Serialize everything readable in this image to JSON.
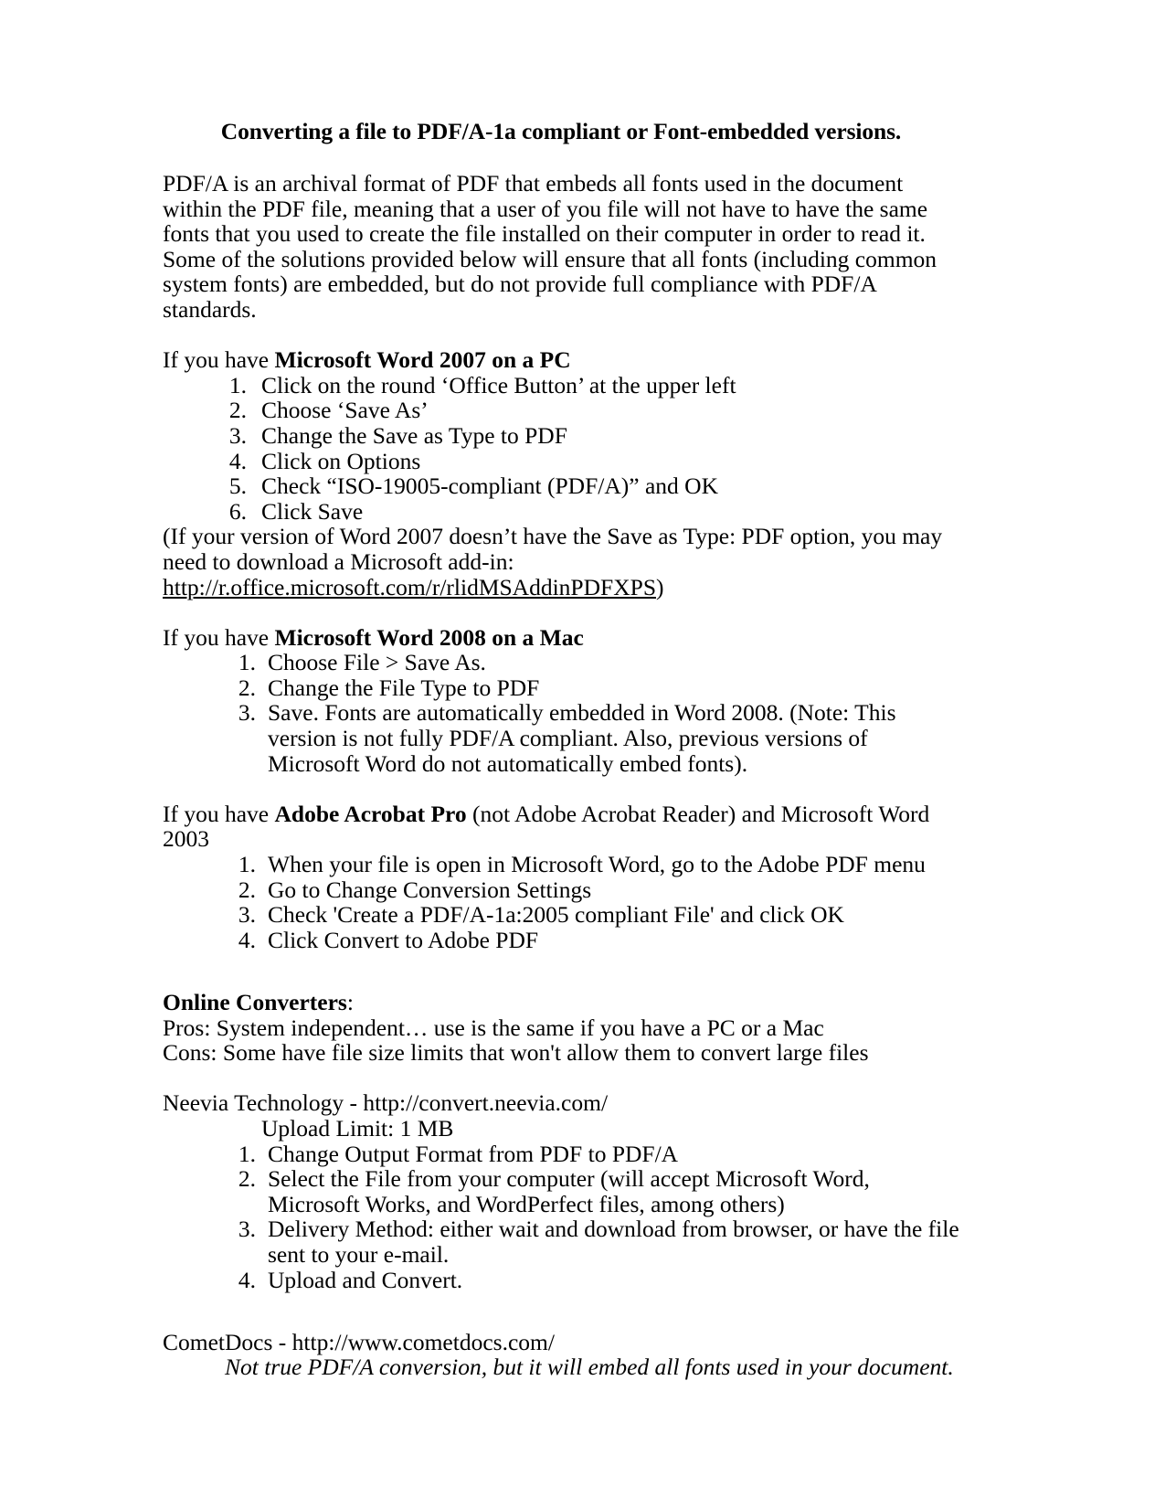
{
  "document": {
    "title": "Converting a file to PDF/A-1a compliant or Font-embedded versions.",
    "intro": "PDF/A is an archival format of PDF that embeds all fonts used in the document within the PDF file, meaning that a user of you file will not have to have the same fonts that you used to create the file installed on their computer in order to read it.   Some of the solutions provided below will ensure that all fonts (including common system fonts) are embedded, but do not provide full compliance with PDF/A standards.",
    "sections": {
      "word2007": {
        "lead_prefix": "If you have ",
        "lead_bold": "Microsoft Word 2007 on a PC",
        "lead_suffix": "",
        "steps": [
          "Click on the round ‘Office Button’ at the upper left",
          "Choose ‘Save As’",
          "Change the Save as Type to PDF",
          "Click on Options",
          "Check “ISO-19005-compliant (PDF/A)” and OK",
          "Click Save"
        ],
        "note_prefix": "(If your version of Word 2007 doesn’t have the Save as Type: PDF option, you may need to download a Microsoft add-in: ",
        "note_link": "http://r.office.microsoft.com/r/rlidMSAddinPDFXPS",
        "note_suffix": ")"
      },
      "word2008": {
        "lead_prefix": "If you have ",
        "lead_bold": "Microsoft Word 2008 on a Mac",
        "lead_suffix": "",
        "steps": [
          "Choose File > Save As.",
          "Change the File Type to PDF",
          "Save.  Fonts are automatically embedded in Word 2008.  (Note: This version is not fully PDF/A compliant.  Also, previous versions of Microsoft Word do not automatically embed fonts)."
        ]
      },
      "acrobat": {
        "lead_prefix": "If you have ",
        "lead_bold": "Adobe Acrobat Pro",
        "lead_suffix": " (not Adobe Acrobat Reader) and Microsoft Word 2003",
        "steps": [
          "When your file is open in Microsoft Word, go to the Adobe PDF menu",
          "Go to Change Conversion Settings",
          "Check 'Create a PDF/A-1a:2005 compliant File' and click OK",
          "Click Convert to Adobe PDF"
        ]
      },
      "online_converters": {
        "heading_bold": "Online Converters",
        "heading_suffix": ":",
        "pros": "Pros:  System independent… use is the same if you have a PC or a Mac",
        "cons": "Cons: Some have file size limits that won't allow them to convert large files"
      },
      "neevia": {
        "name_and_url": "Neevia Technology - http://convert.neevia.com/",
        "upload_limit": "Upload Limit: 1 MB",
        "steps": [
          "Change Output Format from PDF to PDF/A",
          "Select the File from your computer  (will accept Microsoft Word, Microsoft Works,  and WordPerfect files, among others)",
          "Delivery Method: either wait and download from browser, or have the file sent to your e-mail.",
          "Upload and Convert."
        ]
      },
      "cometdocs": {
        "name_and_url": "CometDocs - http://www.cometdocs.com/",
        "note_italic": "Not true PDF/A conversion, but it will embed all fonts used in your document."
      }
    }
  }
}
